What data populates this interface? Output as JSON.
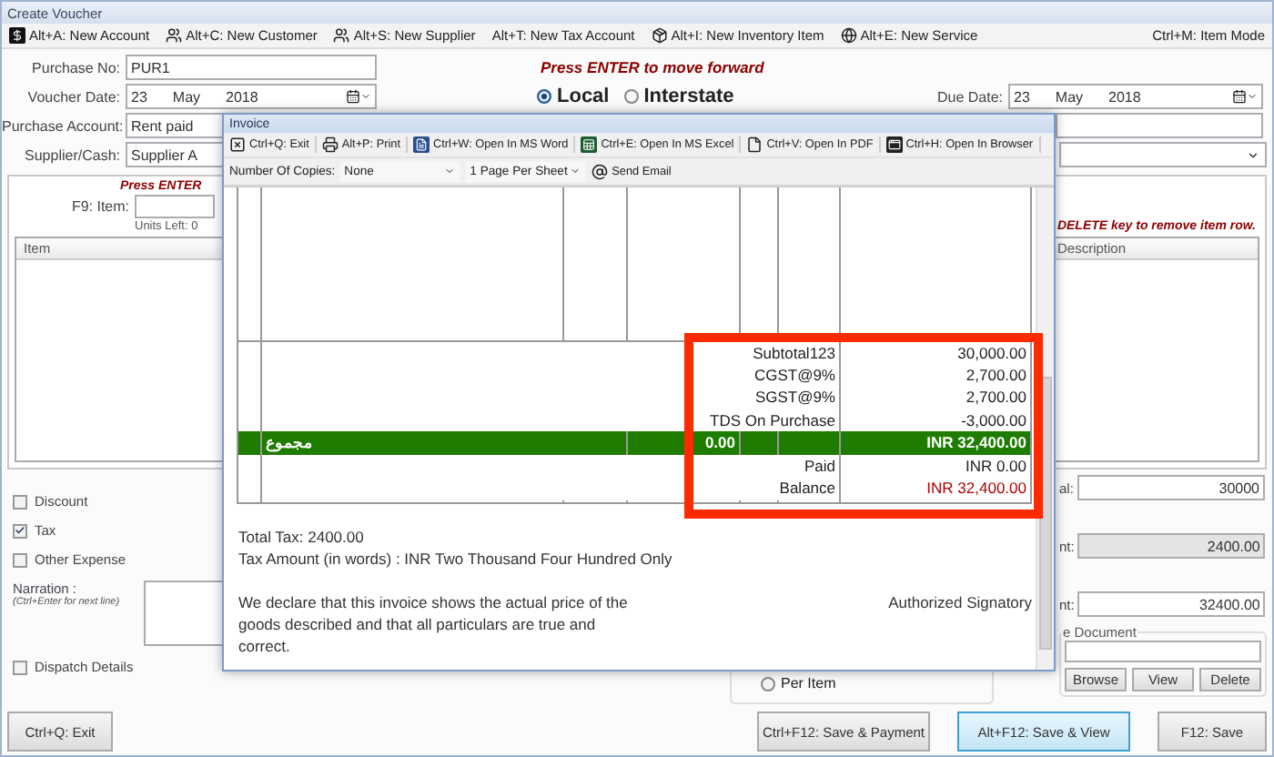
{
  "window": {
    "title": "Create Voucher"
  },
  "toolbar": {
    "items": [
      "Alt+A: New Account",
      "Alt+C: New Customer",
      "Alt+S: New Supplier",
      "Alt+T: New Tax Account",
      "Alt+I: New Inventory Item",
      "Alt+E: New Service"
    ],
    "mode": "Ctrl+M: Item Mode"
  },
  "header": {
    "message": "Press ENTER to move forward",
    "fields": [
      {
        "label": "Purchase No:",
        "value": "PUR1"
      },
      {
        "label": "Voucher Date:",
        "day": "23",
        "month": "May",
        "year": "2018"
      },
      {
        "label": "Purchase Account:",
        "value": "Rent paid"
      },
      {
        "label": "Supplier/Cash:",
        "value": "Supplier A"
      }
    ],
    "tax_type": [
      {
        "label": "Local",
        "selected": true
      },
      {
        "label": "Interstate",
        "selected": false
      }
    ],
    "due_date": {
      "label": "Due Date:",
      "day": "23",
      "month": "May",
      "year": "2018"
    }
  },
  "items_panel": {
    "hint": "Press ENTER",
    "item_label": "F9: Item:",
    "units_left": "Units Left: 0",
    "delete_hint": "DELETE key to remove item row.",
    "columns": [
      "Item",
      "Description"
    ]
  },
  "options": [
    {
      "label": "Discount",
      "checked": false
    },
    {
      "label": "Tax",
      "checked": true
    },
    {
      "label": "Other Expense",
      "checked": false
    }
  ],
  "narration": {
    "label": "Narration :",
    "hint": "(Ctrl+Enter for next line)"
  },
  "dispatch": {
    "label": "Dispatch Details",
    "checked": false
  },
  "per_item": {
    "label": "Per Item",
    "selected": false
  },
  "totals": [
    {
      "label": "al:",
      "value": "30000",
      "disabled": false
    },
    {
      "label": "nt:",
      "value": "2400.00",
      "disabled": true
    },
    {
      "label": "nt:",
      "value": "32400.00",
      "disabled": false
    }
  ],
  "document": {
    "legend": "e Document",
    "buttons": [
      "Browse",
      "View",
      "Delete"
    ]
  },
  "footer_buttons": [
    {
      "label": "Ctrl+Q: Exit",
      "focused": false
    },
    {
      "label": "Ctrl+F12: Save & Payment",
      "focused": false
    },
    {
      "label": "Alt+F12: Save & View",
      "focused": true
    },
    {
      "label": "F12: Save",
      "focused": false
    }
  ],
  "invoice": {
    "title": "Invoice",
    "actions": [
      "Ctrl+Q: Exit",
      "Alt+P: Print",
      "Ctrl+W: Open In MS Word",
      "Ctrl+E: Open In MS Excel",
      "Ctrl+V: Open In PDF",
      "Ctrl+H: Open In Browser"
    ],
    "copies_label": "Number Of Copies:",
    "copies": "None",
    "pages": "1 Page Per Sheet",
    "email": "Send Email",
    "summary": [
      {
        "kind": "line",
        "label": "Subtotal123",
        "value": "30,000.00"
      },
      {
        "kind": "line",
        "label": "CGST@9%",
        "value": "2,700.00"
      },
      {
        "kind": "line",
        "label": "SGST@9%",
        "value": "2,700.00"
      },
      {
        "kind": "line",
        "label": "TDS On Purchase",
        "value": "-3,000.00"
      },
      {
        "kind": "total",
        "label": "مجموع",
        "quantity": "0.00",
        "value": "INR 32,400.00"
      },
      {
        "kind": "line",
        "label": "Paid",
        "value": "INR 0.00"
      },
      {
        "kind": "due",
        "label": "Balance",
        "value": "INR 32,400.00"
      }
    ],
    "total_tax": "Total Tax: 2400.00",
    "tax_words": "Tax Amount (in words) : INR Two Thousand Four Hundred Only",
    "declaration": "We declare that this invoice shows the actual price of the goods described and that all particulars are true and correct.",
    "signatory": "Authorized Signatory"
  }
}
